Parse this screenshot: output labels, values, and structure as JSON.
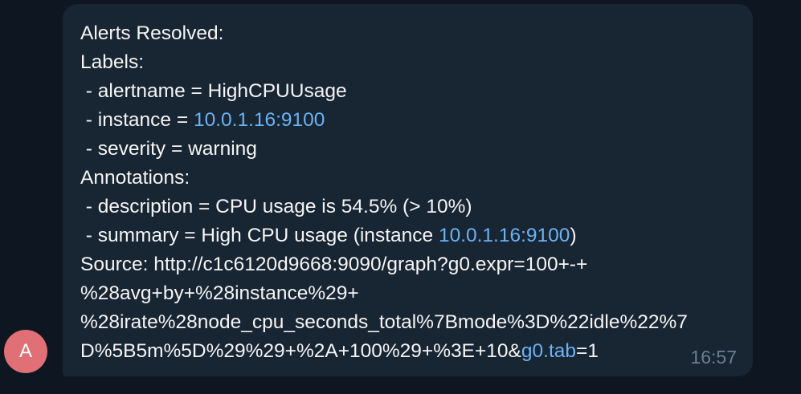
{
  "message": {
    "sender_initial": "A",
    "time": "16:57",
    "lines": {
      "l1": "Alerts Resolved:",
      "l2": "Labels:",
      "l3": " - alertname = HighCPUUsage",
      "l4_prefix": " - instance = ",
      "l4_link": "10.0.1.16:9100",
      "l5": " - severity = warning",
      "l6": "Annotations:",
      "l7": " - description = CPU usage is 54.5% (> 10%)",
      "l8_prefix": " - summary = High CPU usage (instance ",
      "l8_link": "10.0.1.16:9100",
      "l8_suffix": ")",
      "l9": "Source: http://c1c6120d9668:9090/graph?g0.expr=100+-+",
      "l10": "%28avg+by+%28instance%29+",
      "l11": "%28irate%28node_cpu_seconds_total%7Bmode%3D%22idle%22%7",
      "l12_prefix": "D%5B5m%5D%29%29+%2A+100%29+%3E+10&",
      "l12_link": "g0.tab",
      "l12_suffix": "=1"
    }
  },
  "colors": {
    "background": "#0e1621",
    "bubble": "#182533",
    "text": "#f5f5f5",
    "link": "#6ab3f3",
    "time": "#6d7f8f",
    "avatar": "#e17076"
  }
}
